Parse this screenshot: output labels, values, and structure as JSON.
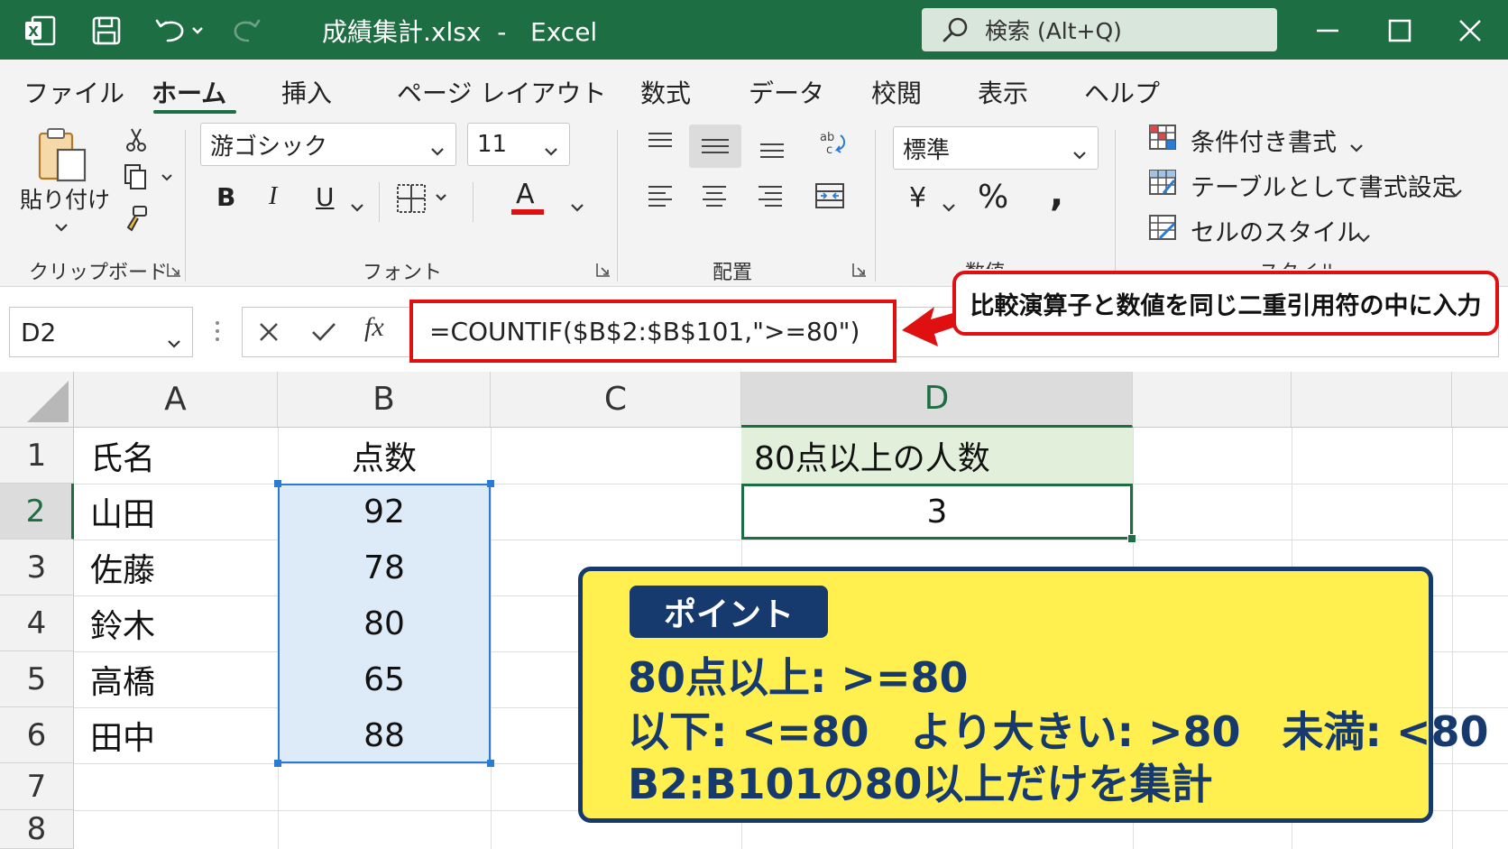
{
  "window": {
    "filename": "成績集計.xlsx",
    "app": "Excel",
    "search_placeholder": "検索 (Alt+Q)"
  },
  "menu_tabs": [
    "ファイル",
    "ホーム",
    "挿入",
    "ページ レイアウト",
    "数式",
    "データ",
    "校閲",
    "表示",
    "ヘルプ"
  ],
  "ribbon": {
    "clipboard": {
      "paste_label": "貼り付け",
      "group_label": "クリップボード"
    },
    "font": {
      "family": "游ゴシック",
      "size": "11",
      "group_label": "フォント",
      "bold": "B",
      "italic": "I",
      "underline": "U",
      "font_color_glyph": "A"
    },
    "alignment": {
      "group_label": "配置"
    },
    "number": {
      "format": "標準",
      "currency": "¥",
      "percent": "%",
      "comma": ",",
      "group_label": "数値"
    },
    "styles": {
      "conditional": "条件付き書式",
      "table": "テーブルとして書式設定",
      "cell_styles": "セルのスタイル",
      "group_label": "スタイル"
    },
    "accent_color": "#1e6e44",
    "font_color": "#e01010"
  },
  "formula_bar": {
    "name_box": "D2",
    "fx": "fx",
    "formula": "=COUNTIF($B$2:$B$101,\">=80\")"
  },
  "callout": "比較演算子と数値を同じ二重引用符の中に入力",
  "columns": [
    "A",
    "B",
    "C",
    "D"
  ],
  "rows": [
    "1",
    "2",
    "3",
    "4",
    "5",
    "6",
    "7",
    "8"
  ],
  "cells": {
    "A1": "氏名",
    "B1": "点数",
    "D1": "80点以上の人数",
    "A2": "山田",
    "B2": "92",
    "D2": "3",
    "A3": "佐藤",
    "B3": "78",
    "A4": "鈴木",
    "B4": "80",
    "A5": "高橋",
    "B5": "65",
    "A6": "田中",
    "B6": "88"
  },
  "point": {
    "badge": "ポイント",
    "line1": "80点以上: >=80",
    "line2": "以下: <=80　より大きい: >80　未満: <80",
    "line3": "B2:B101の80以上だけを集計"
  }
}
